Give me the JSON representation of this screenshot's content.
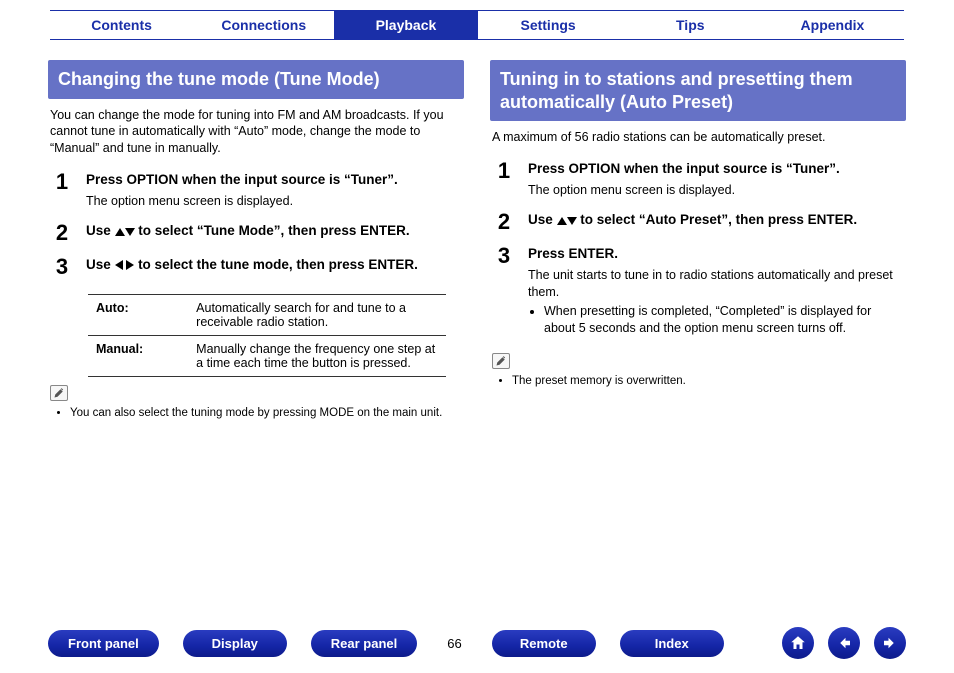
{
  "tabs": {
    "contents": "Contents",
    "connections": "Connections",
    "playback": "Playback",
    "settings": "Settings",
    "tips": "Tips",
    "appendix": "Appendix"
  },
  "left": {
    "heading": "Changing the tune mode (Tune Mode)",
    "intro": "You can change the mode for tuning into FM and AM broadcasts. If you cannot tune in automatically with “Auto” mode, change the mode to “Manual” and tune in manually.",
    "steps": {
      "s1": {
        "num": "1",
        "title": "Press OPTION when the input source is “Tuner”.",
        "sub": "The option menu screen is displayed."
      },
      "s2": {
        "num": "2",
        "title_pre": "Use ",
        "title_post": " to select “Tune Mode”, then press ENTER."
      },
      "s3": {
        "num": "3",
        "title_pre": "Use ",
        "title_post": " to select the tune mode, then press ENTER."
      }
    },
    "modes": {
      "auto_k": "Auto:",
      "auto_v": "Automatically search for and tune to a receivable radio station.",
      "manual_k": "Manual:",
      "manual_v": "Manually change the frequency one step at a time each time the button is pressed."
    },
    "note1": "You can also select the tuning mode by pressing MODE on the main unit."
  },
  "right": {
    "heading": "Tuning in to stations and presetting them automatically (Auto Preset)",
    "intro": "A maximum of 56 radio stations can be automatically preset.",
    "steps": {
      "s1": {
        "num": "1",
        "title": "Press OPTION when the input source is “Tuner”.",
        "sub": "The option menu screen is displayed."
      },
      "s2": {
        "num": "2",
        "title_pre": "Use ",
        "title_post": " to select “Auto Preset”, then press ENTER."
      },
      "s3": {
        "num": "3",
        "title": "Press ENTER.",
        "sub": "The unit starts to tune in to radio stations automatically and preset them.",
        "bullet": "When presetting is completed, “Completed” is displayed for about 5 seconds and the option menu screen turns off."
      }
    },
    "note1": "The preset memory is overwritten."
  },
  "bottom": {
    "front": "Front panel",
    "display": "Display",
    "rear": "Rear panel",
    "page": "66",
    "remote": "Remote",
    "index": "Index"
  }
}
